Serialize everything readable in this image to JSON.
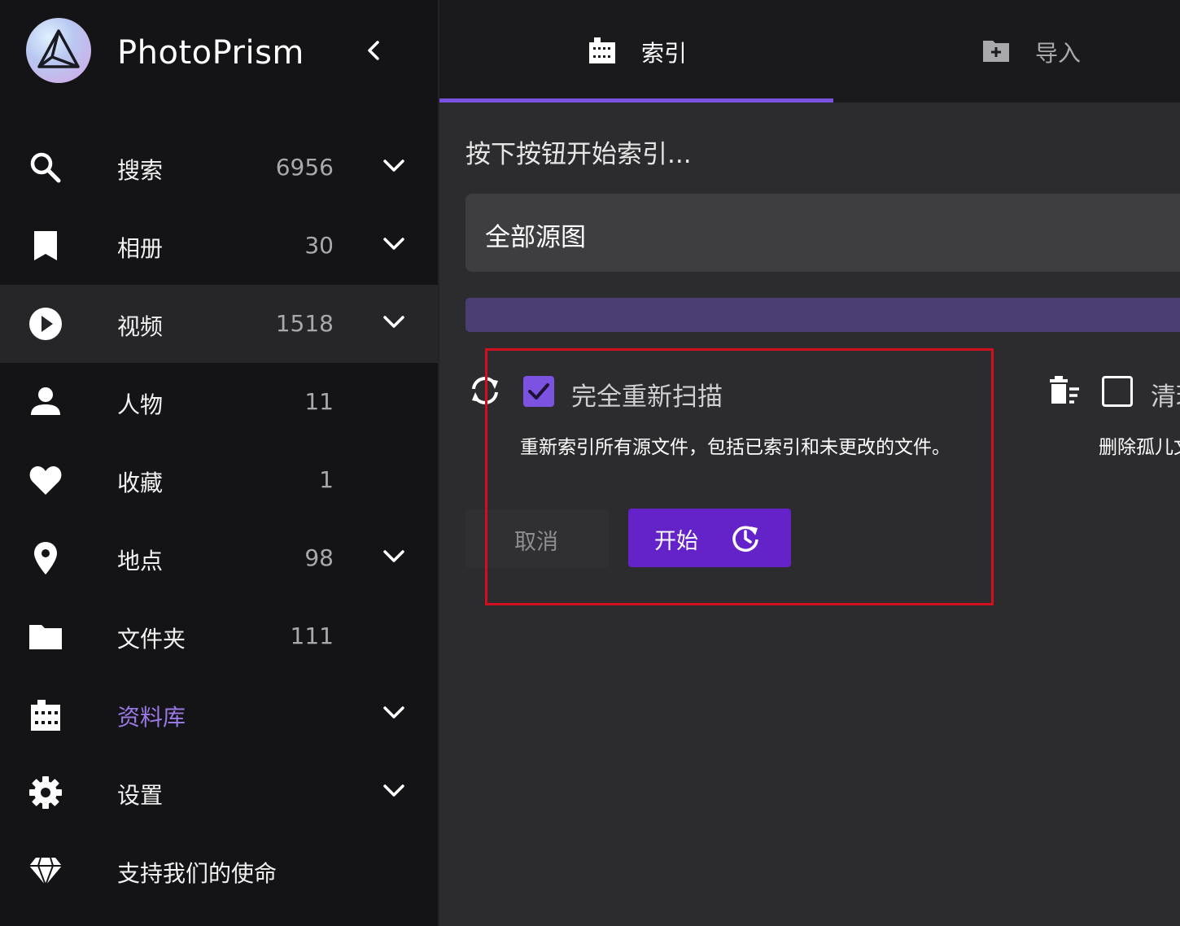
{
  "app": {
    "name": "PhotoPrism"
  },
  "sidebar": {
    "items": [
      {
        "label": "搜索",
        "count": "6956",
        "icon": "search-icon",
        "chevron": true
      },
      {
        "label": "相册",
        "count": "30",
        "icon": "bookmark-icon",
        "chevron": true
      },
      {
        "label": "视频",
        "count": "1518",
        "icon": "play-circle-icon",
        "chevron": true,
        "active": true
      },
      {
        "label": "人物",
        "count": "11",
        "icon": "person-icon",
        "chevron": false
      },
      {
        "label": "收藏",
        "count": "1",
        "icon": "heart-icon",
        "chevron": false
      },
      {
        "label": "地点",
        "count": "98",
        "icon": "map-pin-icon",
        "chevron": true
      },
      {
        "label": "文件夹",
        "count": "111",
        "icon": "folder-icon",
        "chevron": false
      },
      {
        "label": "资料库",
        "count": "",
        "icon": "film-library-icon",
        "chevron": true,
        "highlighted": true
      },
      {
        "label": "设置",
        "count": "",
        "icon": "gear-icon",
        "chevron": true
      },
      {
        "label": "支持我们的使命",
        "count": "",
        "icon": "diamond-icon",
        "chevron": false
      }
    ]
  },
  "tabs": [
    {
      "label": "索引",
      "icon": "film-icon",
      "active": true
    },
    {
      "label": "导入",
      "icon": "folder-plus-icon",
      "active": false
    }
  ],
  "index": {
    "prompt": "按下按钮开始索引...",
    "select_value": "全部源图",
    "progress": 0,
    "rescan": {
      "label": "完全重新扫描",
      "checked": true,
      "description": "重新索引所有源文件，包括已索引和未更改的文件。"
    },
    "cleanup": {
      "label": "清理",
      "checked": false,
      "description": "删除孤儿文件"
    },
    "cancel_label": "取消",
    "start_label": "开始"
  },
  "colors": {
    "accent": "#7b52e0",
    "start_button": "#6422c9",
    "highlight_box": "#d0101f"
  }
}
